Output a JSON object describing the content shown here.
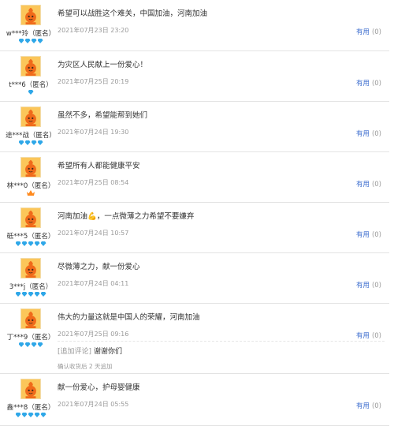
{
  "reviews": [
    {
      "user": "w***玲（匿名）",
      "content": "希望可以战胜这个难关，中国加油，河南加油",
      "date": "2021年07月23日 23:20",
      "useful_label": "有用",
      "useful_count": "(0)",
      "level": 4,
      "badge": "diamond"
    },
    {
      "user": "t***6（匿名）",
      "content": "为灾区人民献上一份爱心！",
      "date": "2021年07月25日 20:19",
      "useful_label": "有用",
      "useful_count": "(0)",
      "level": 1,
      "badge": "diamond"
    },
    {
      "user": "途***战（匿名）",
      "content": "虽然不多，希望能帮到她们",
      "date": "2021年07月24日 19:30",
      "useful_label": "有用",
      "useful_count": "(0)",
      "level": 4,
      "badge": "diamond"
    },
    {
      "user": "林***0（匿名）",
      "content": "希望所有人都能健康平安",
      "date": "2021年07月25日 08:54",
      "useful_label": "有用",
      "useful_count": "(0)",
      "level": 1,
      "badge": "crown"
    },
    {
      "user": "砥***5（匿名）",
      "content": "河南加油💪，一点微薄之力希望不要嫌弃",
      "date": "2021年07月24日 10:57",
      "useful_label": "有用",
      "useful_count": "(0)",
      "level": 5,
      "badge": "diamond"
    },
    {
      "user": "3***j（匿名）",
      "content": "尽微薄之力，献一份爱心",
      "date": "2021年07月24日 04:11",
      "useful_label": "有用",
      "useful_count": "(0)",
      "level": 5,
      "badge": "diamond"
    },
    {
      "user": "丁***9（匿名）",
      "content": "伟大的力量这就是中国人的荣耀，河南加油",
      "date": "2021年07月25日 09:16",
      "useful_label": "有用",
      "useful_count": "(0)",
      "level": 4,
      "badge": "diamond",
      "append_tag": "[追加评论]",
      "append_text": "谢谢你们",
      "append_note": "确认收货后 2 天追加"
    },
    {
      "user": "鑫***8（匿名）",
      "content": "献一份爱心，护母婴健康",
      "date": "2021年07月24日 05:55",
      "useful_label": "有用",
      "useful_count": "(0)",
      "level": 5,
      "badge": "diamond"
    }
  ],
  "colors": {
    "link": "#3c6dcf",
    "muted": "#999999",
    "gem": "#2ea7e8",
    "avatar_bg": "#fbc65a"
  },
  "icons": {
    "avatar": "orange-mascot-icon",
    "level_badge": "diamond-icon",
    "crown": "crown-icon"
  }
}
